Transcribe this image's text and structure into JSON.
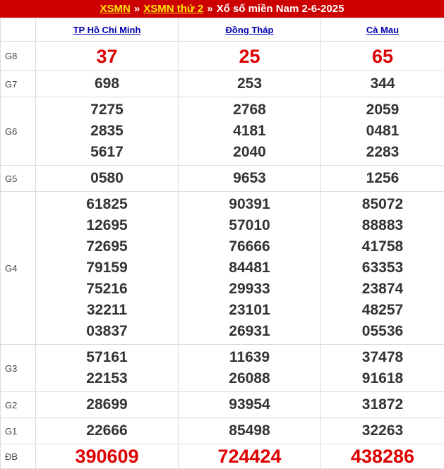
{
  "breadcrumb": {
    "link1": "XSMN",
    "sep1": "»",
    "link2": "XSMN thứ 2",
    "sep2": "»",
    "title": "Xổ số miền Nam 2-6-2025"
  },
  "provinces": [
    "TP Hồ Chí Minh",
    "Đồng Tháp",
    "Cà Mau"
  ],
  "prizes": [
    {
      "label": "G8",
      "results": [
        [
          "37"
        ],
        [
          "25"
        ],
        [
          "65"
        ]
      ]
    },
    {
      "label": "G7",
      "results": [
        [
          "698"
        ],
        [
          "253"
        ],
        [
          "344"
        ]
      ]
    },
    {
      "label": "G6",
      "results": [
        [
          "7275",
          "2835",
          "5617"
        ],
        [
          "2768",
          "4181",
          "2040"
        ],
        [
          "2059",
          "0481",
          "2283"
        ]
      ]
    },
    {
      "label": "G5",
      "results": [
        [
          "0580"
        ],
        [
          "9653"
        ],
        [
          "1256"
        ]
      ]
    },
    {
      "label": "G4",
      "results": [
        [
          "61825",
          "12695",
          "72695",
          "79159",
          "75216",
          "32211",
          "03837"
        ],
        [
          "90391",
          "57010",
          "76666",
          "84481",
          "29933",
          "23101",
          "26931"
        ],
        [
          "85072",
          "88883",
          "41758",
          "63353",
          "23874",
          "48257",
          "05536"
        ]
      ]
    },
    {
      "label": "G3",
      "results": [
        [
          "57161",
          "22153"
        ],
        [
          "11639",
          "26088"
        ],
        [
          "37478",
          "91618"
        ]
      ]
    },
    {
      "label": "G2",
      "results": [
        [
          "28699"
        ],
        [
          "93954"
        ],
        [
          "31872"
        ]
      ]
    },
    {
      "label": "G1",
      "results": [
        [
          "22666"
        ],
        [
          "85498"
        ],
        [
          "32263"
        ]
      ]
    },
    {
      "label": "ĐB",
      "results": [
        [
          "390609"
        ],
        [
          "724424"
        ],
        [
          "438286"
        ]
      ]
    }
  ],
  "colors": {
    "header_bg": "#cc0000",
    "header_link": "#ffe600",
    "highlight_number": "#dd0000",
    "province_link": "#0000aa"
  }
}
